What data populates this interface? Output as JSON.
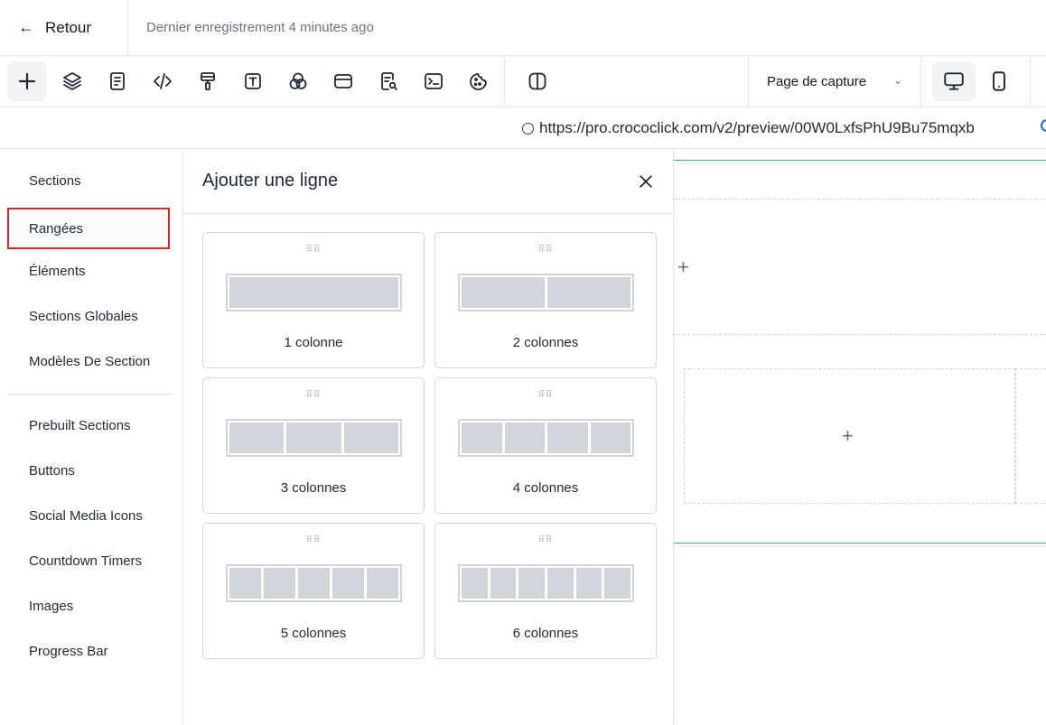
{
  "header": {
    "back_label": "Retour",
    "save_status": "Dernier enregistrement 4 minutes ago"
  },
  "toolbar": {
    "tools": [
      "plus-icon",
      "layers-icon",
      "form-icon",
      "code-icon",
      "paint-roller-icon",
      "text-icon",
      "color-circles-icon",
      "window-icon",
      "document-search-icon",
      "terminal-icon",
      "cookie-icon"
    ],
    "layout_tool": "columns-toggle-icon",
    "page_select_value": "Page de capture",
    "devices": [
      "desktop-icon",
      "mobile-icon"
    ]
  },
  "urlbar": {
    "url": "https://pro.crococlick.com/v2/preview/00W0LxfsPhU9Bu75mqxb"
  },
  "sidebar": {
    "items": [
      {
        "label": "Sections"
      },
      {
        "label": "Rangées"
      },
      {
        "label": "Éléments"
      },
      {
        "label": "Sections Globales"
      },
      {
        "label": "Modèles De Section"
      },
      {
        "label": "Prebuilt Sections"
      },
      {
        "label": "Buttons"
      },
      {
        "label": "Social Media Icons"
      },
      {
        "label": "Countdown Timers"
      },
      {
        "label": "Images"
      },
      {
        "label": "Progress Bar"
      }
    ],
    "selected": "Rangées"
  },
  "panel": {
    "title": "Ajouter une ligne",
    "cards": [
      {
        "label": "1 colonne",
        "columns": 1
      },
      {
        "label": "2 colonnes",
        "columns": 2
      },
      {
        "label": "3 colonnes",
        "columns": 3
      },
      {
        "label": "4 colonnes",
        "columns": 4
      },
      {
        "label": "5 colonnes",
        "columns": 5
      },
      {
        "label": "6 colonnes",
        "columns": 6
      }
    ]
  },
  "canvas": {
    "plus_symbol": "+"
  },
  "colors": {
    "selection_border": "#dc2626",
    "section_line": "#22c55e",
    "link_accent": "#2563eb"
  }
}
